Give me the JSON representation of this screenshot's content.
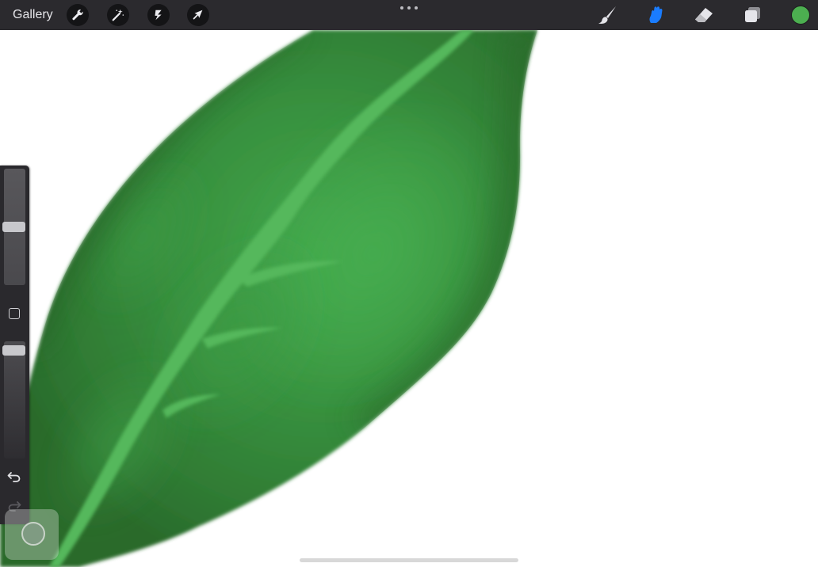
{
  "toolbar": {
    "gallery_label": "Gallery",
    "left_tools": [
      "wrench-icon",
      "magic-wand-icon",
      "selection-icon",
      "transform-arrow-icon"
    ],
    "right_tools": [
      "brush-icon",
      "smudge-icon",
      "eraser-icon",
      "layers-icon"
    ],
    "active_tool": "smudge",
    "active_color": "#4caf50",
    "accent_color": "#1a7cff"
  },
  "sidebar": {
    "brush_size_level": 0.5,
    "opacity_level": 0.96,
    "controls": [
      "size-slider",
      "modify-button",
      "opacity-slider",
      "undo-button",
      "redo-button"
    ]
  },
  "canvas": {
    "subject": "green-leaf-painting",
    "leaf_colors": {
      "dark": "#2b6a2a",
      "mid": "#2f7d34",
      "light": "#3fa34b",
      "vein": "#55b85c"
    }
  }
}
